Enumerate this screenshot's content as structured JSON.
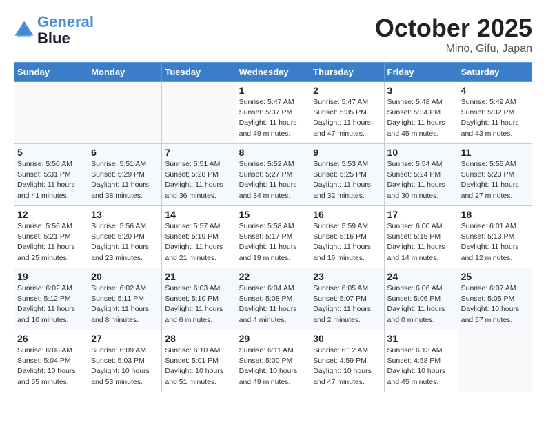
{
  "header": {
    "logo_line1": "General",
    "logo_line2": "Blue",
    "month": "October 2025",
    "location": "Mino, Gifu, Japan"
  },
  "weekdays": [
    "Sunday",
    "Monday",
    "Tuesday",
    "Wednesday",
    "Thursday",
    "Friday",
    "Saturday"
  ],
  "weeks": [
    [
      {
        "day": "",
        "info": ""
      },
      {
        "day": "",
        "info": ""
      },
      {
        "day": "",
        "info": ""
      },
      {
        "day": "1",
        "info": "Sunrise: 5:47 AM\nSunset: 5:37 PM\nDaylight: 11 hours and 49 minutes."
      },
      {
        "day": "2",
        "info": "Sunrise: 5:47 AM\nSunset: 5:35 PM\nDaylight: 11 hours and 47 minutes."
      },
      {
        "day": "3",
        "info": "Sunrise: 5:48 AM\nSunset: 5:34 PM\nDaylight: 11 hours and 45 minutes."
      },
      {
        "day": "4",
        "info": "Sunrise: 5:49 AM\nSunset: 5:32 PM\nDaylight: 11 hours and 43 minutes."
      }
    ],
    [
      {
        "day": "5",
        "info": "Sunrise: 5:50 AM\nSunset: 5:31 PM\nDaylight: 11 hours and 41 minutes."
      },
      {
        "day": "6",
        "info": "Sunrise: 5:51 AM\nSunset: 5:29 PM\nDaylight: 11 hours and 38 minutes."
      },
      {
        "day": "7",
        "info": "Sunrise: 5:51 AM\nSunset: 5:28 PM\nDaylight: 11 hours and 36 minutes."
      },
      {
        "day": "8",
        "info": "Sunrise: 5:52 AM\nSunset: 5:27 PM\nDaylight: 11 hours and 34 minutes."
      },
      {
        "day": "9",
        "info": "Sunrise: 5:53 AM\nSunset: 5:25 PM\nDaylight: 11 hours and 32 minutes."
      },
      {
        "day": "10",
        "info": "Sunrise: 5:54 AM\nSunset: 5:24 PM\nDaylight: 11 hours and 30 minutes."
      },
      {
        "day": "11",
        "info": "Sunrise: 5:55 AM\nSunset: 5:23 PM\nDaylight: 11 hours and 27 minutes."
      }
    ],
    [
      {
        "day": "12",
        "info": "Sunrise: 5:56 AM\nSunset: 5:21 PM\nDaylight: 11 hours and 25 minutes."
      },
      {
        "day": "13",
        "info": "Sunrise: 5:56 AM\nSunset: 5:20 PM\nDaylight: 11 hours and 23 minutes."
      },
      {
        "day": "14",
        "info": "Sunrise: 5:57 AM\nSunset: 5:19 PM\nDaylight: 11 hours and 21 minutes."
      },
      {
        "day": "15",
        "info": "Sunrise: 5:58 AM\nSunset: 5:17 PM\nDaylight: 11 hours and 19 minutes."
      },
      {
        "day": "16",
        "info": "Sunrise: 5:59 AM\nSunset: 5:16 PM\nDaylight: 11 hours and 16 minutes."
      },
      {
        "day": "17",
        "info": "Sunrise: 6:00 AM\nSunset: 5:15 PM\nDaylight: 11 hours and 14 minutes."
      },
      {
        "day": "18",
        "info": "Sunrise: 6:01 AM\nSunset: 5:13 PM\nDaylight: 11 hours and 12 minutes."
      }
    ],
    [
      {
        "day": "19",
        "info": "Sunrise: 6:02 AM\nSunset: 5:12 PM\nDaylight: 11 hours and 10 minutes."
      },
      {
        "day": "20",
        "info": "Sunrise: 6:02 AM\nSunset: 5:11 PM\nDaylight: 11 hours and 8 minutes."
      },
      {
        "day": "21",
        "info": "Sunrise: 6:03 AM\nSunset: 5:10 PM\nDaylight: 11 hours and 6 minutes."
      },
      {
        "day": "22",
        "info": "Sunrise: 6:04 AM\nSunset: 5:08 PM\nDaylight: 11 hours and 4 minutes."
      },
      {
        "day": "23",
        "info": "Sunrise: 6:05 AM\nSunset: 5:07 PM\nDaylight: 11 hours and 2 minutes."
      },
      {
        "day": "24",
        "info": "Sunrise: 6:06 AM\nSunset: 5:06 PM\nDaylight: 11 hours and 0 minutes."
      },
      {
        "day": "25",
        "info": "Sunrise: 6:07 AM\nSunset: 5:05 PM\nDaylight: 10 hours and 57 minutes."
      }
    ],
    [
      {
        "day": "26",
        "info": "Sunrise: 6:08 AM\nSunset: 5:04 PM\nDaylight: 10 hours and 55 minutes."
      },
      {
        "day": "27",
        "info": "Sunrise: 6:09 AM\nSunset: 5:03 PM\nDaylight: 10 hours and 53 minutes."
      },
      {
        "day": "28",
        "info": "Sunrise: 6:10 AM\nSunset: 5:01 PM\nDaylight: 10 hours and 51 minutes."
      },
      {
        "day": "29",
        "info": "Sunrise: 6:11 AM\nSunset: 5:00 PM\nDaylight: 10 hours and 49 minutes."
      },
      {
        "day": "30",
        "info": "Sunrise: 6:12 AM\nSunset: 4:59 PM\nDaylight: 10 hours and 47 minutes."
      },
      {
        "day": "31",
        "info": "Sunrise: 6:13 AM\nSunset: 4:58 PM\nDaylight: 10 hours and 45 minutes."
      },
      {
        "day": "",
        "info": ""
      }
    ]
  ]
}
